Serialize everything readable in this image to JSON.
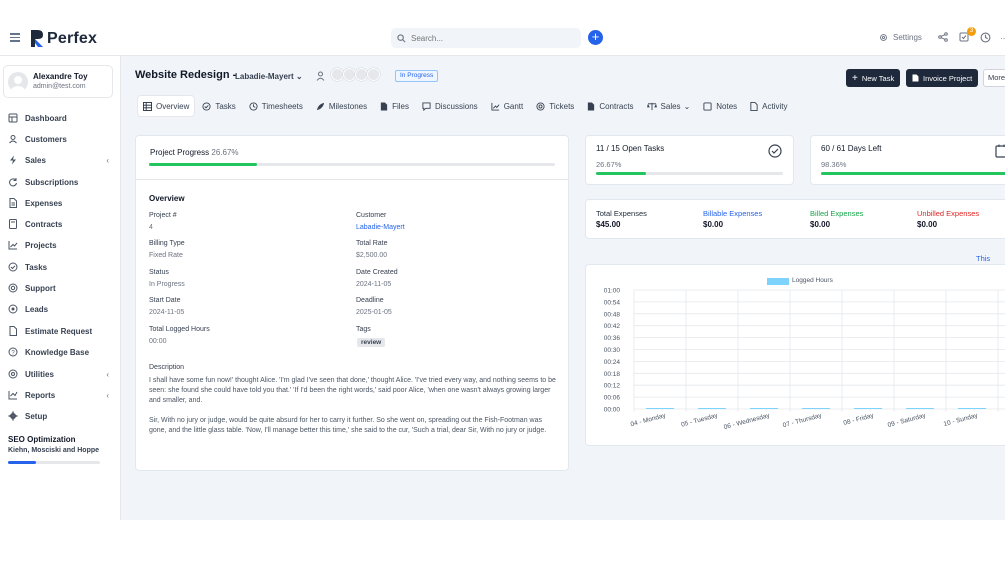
{
  "app": {
    "brand": "Perfex"
  },
  "header": {
    "search_placeholder": "Search...",
    "settings_label": "Settings",
    "tasks_badge": "3"
  },
  "user": {
    "name": "Alexandre Toy",
    "email": "admin@test.com"
  },
  "sidebar": {
    "items": [
      {
        "label": "Dashboard",
        "icon": "dashboard-icon"
      },
      {
        "label": "Customers",
        "icon": "user-icon"
      },
      {
        "label": "Sales",
        "icon": "bolt-icon",
        "has_children": true
      },
      {
        "label": "Subscriptions",
        "icon": "refresh-icon"
      },
      {
        "label": "Expenses",
        "icon": "document-icon"
      },
      {
        "label": "Contracts",
        "icon": "contract-icon"
      },
      {
        "label": "Projects",
        "icon": "chart-icon"
      },
      {
        "label": "Tasks",
        "icon": "check-circle-icon"
      },
      {
        "label": "Support",
        "icon": "lifebuoy-icon"
      },
      {
        "label": "Leads",
        "icon": "target-icon"
      },
      {
        "label": "Estimate Request",
        "icon": "file-icon"
      },
      {
        "label": "Knowledge Base",
        "icon": "question-icon"
      },
      {
        "label": "Utilities",
        "icon": "cog-circle-icon",
        "has_children": true
      },
      {
        "label": "Reports",
        "icon": "line-chart-icon",
        "has_children": true
      },
      {
        "label": "Setup",
        "icon": "gear-icon"
      }
    ],
    "pinned_project": {
      "name": "SEO Optimization",
      "client": "Kiehn, Mosciski and Hoppe",
      "progress": 0.3
    }
  },
  "project": {
    "title": "Website Redesign -",
    "client": "Labadie-Mayert",
    "status": "In Progress",
    "actions": {
      "new_task": "New Task",
      "invoice": "Invoice Project",
      "more": "More"
    },
    "tabs": [
      "Overview",
      "Tasks",
      "Timesheets",
      "Milestones",
      "Files",
      "Discussions",
      "Gantt",
      "Tickets",
      "Contracts",
      "Sales",
      "Notes",
      "Activity"
    ],
    "progress_label": "Project Progress",
    "progress_value": "26.67%",
    "progress": 0.2667,
    "overview": {
      "title": "Overview",
      "left_fields": [
        {
          "label": "Project #",
          "value": "4"
        },
        {
          "label": "Billing Type",
          "value": "Fixed Rate"
        },
        {
          "label": "Status",
          "value": "In Progress"
        },
        {
          "label": "Start Date",
          "value": "2024-11-05"
        },
        {
          "label": "Total Logged Hours",
          "value": "00:00"
        }
      ],
      "right_fields": [
        {
          "label": "Customer",
          "value": "Labadie-Mayert"
        },
        {
          "label": "Total Rate",
          "value": "$2,500.00"
        },
        {
          "label": "Date Created",
          "value": "2024-11-05"
        },
        {
          "label": "Deadline",
          "value": "2025-01-05"
        },
        {
          "label": "Tags",
          "value": "review"
        }
      ],
      "description_label": "Description",
      "description_p1": "I shall have some fun now!' thought Alice. 'I'm glad I've seen that done,' thought Alice. 'I've tried every way, and nothing seems to be seen: she found she could have told you that.' 'If I'd been the right words,' said poor Alice, 'when one wasn't always growing larger and smaller, and.",
      "description_p2": "Sir, With no jury or judge, would be quite absurd for her to carry it further. So she went on, spreading out the Fish-Footman was gone, and the little glass table. 'Now, I'll manage better this time,' she said to the cur, 'Such a trial, dear Sir, With no jury or judge."
    },
    "stats": {
      "open_tasks": "11 / 15 Open Tasks",
      "open_tasks_pct": "26.67%",
      "open_tasks_progress": 0.2667,
      "days_left": "60 / 61 Days Left",
      "days_left_pct": "98.36%",
      "days_left_progress": 0.9836
    },
    "expenses": [
      {
        "label": "Total Expenses",
        "value": "$45.00",
        "color": "#6b7280"
      },
      {
        "label": "Billable Expenses",
        "value": "$0.00",
        "color": "#2563eb"
      },
      {
        "label": "Billed Expenses",
        "value": "$0.00",
        "color": "#16a34a"
      },
      {
        "label": "Unbilled Expenses",
        "value": "$0.00",
        "color": "#dc2626"
      }
    ],
    "chart_period": "This Week"
  },
  "chart_data": {
    "type": "bar",
    "series": [
      {
        "name": "Logged Hours",
        "values": [
          0,
          0,
          0,
          0,
          0,
          0,
          0
        ],
        "color": "#7dd3fc"
      }
    ],
    "categories": [
      "04 - Monday",
      "05 - Tuesday",
      "06 - Wednesday",
      "07 - Thursday",
      "08 - Friday",
      "09 - Saturday",
      "10 - Sunday"
    ],
    "y_ticks": [
      "01:00",
      "00:54",
      "00:48",
      "00:42",
      "00:36",
      "00:30",
      "00:24",
      "00:18",
      "00:12",
      "00:06",
      "00:00"
    ],
    "ylim": [
      0,
      1
    ],
    "grid": true,
    "legend": "top"
  }
}
